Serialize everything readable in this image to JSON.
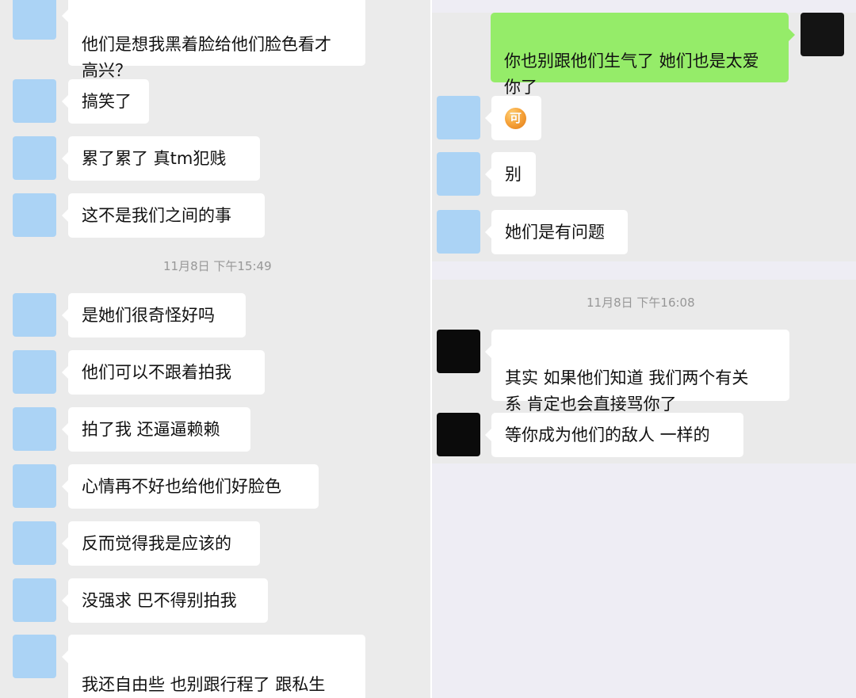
{
  "left_chat": {
    "messages": [
      {
        "text": "他们是想我黑着脸给他们脸色看才\n高兴？"
      },
      {
        "text": "搞笑了"
      },
      {
        "text": "累了累了 真tm犯贱"
      },
      {
        "text": "这不是我们之间的事"
      },
      {
        "text": "是她们很奇怪好吗"
      },
      {
        "text": "他们可以不跟着拍我"
      },
      {
        "text": "拍了我 还逼逼赖赖"
      },
      {
        "text": "心情再不好也给他们好脸色"
      },
      {
        "text": "反而觉得我是应该的"
      },
      {
        "text": "没强求 巴不得别拍我"
      },
      {
        "text": "我还自由些 也别跟行程了 跟私生\n有什么区别"
      }
    ],
    "timestamp": "11月8日 下午15:49"
  },
  "right_chat": {
    "sent_message": "你也别跟他们生气了 她们也是太爱\n你了",
    "received_messages": [
      {
        "emoji": "可",
        "emoji_name": "ke-emoji"
      },
      {
        "text": "别"
      },
      {
        "text": "她们是有问题"
      }
    ],
    "timestamp": "11月8日 下午16:08",
    "later_messages": [
      {
        "text": "其实 如果他们知道 我们两个有关\n系 肯定也会直接骂你了"
      },
      {
        "text": "等你成为他们的敌人 一样的"
      }
    ]
  },
  "colors": {
    "left_background": "#ebebeb",
    "right_background": "#eeedf4",
    "received_bubble": "#ffffff",
    "sent_bubble": "#95ec69",
    "avatar_blue": "#abd3f5",
    "avatar_dark": "#0b0b0b",
    "timestamp_text": "#979797"
  },
  "icons": [
    "avatar",
    "ke-emoji"
  ]
}
